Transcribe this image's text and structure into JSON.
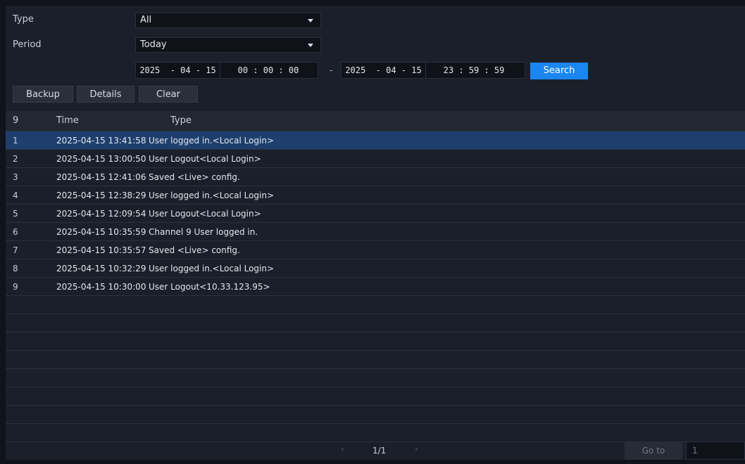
{
  "filters": {
    "type_label": "Type",
    "type_value": "All",
    "period_label": "Period",
    "period_value": "Today",
    "start_date": "2025  - 04 - 15",
    "start_time": "00 : 00 : 00",
    "range_separator": "-",
    "end_date": "2025  - 04 - 15",
    "end_time": "23 : 59 : 59",
    "search_label": "Search"
  },
  "actions": {
    "backup_label": "Backup",
    "details_label": "Details",
    "clear_label": "Clear"
  },
  "table": {
    "headers": {
      "count": "9",
      "time": "Time",
      "type": "Type"
    },
    "rows": [
      {
        "no": "1",
        "time": "2025-04-15 13:41:58",
        "type": "User logged in.<Local Login>",
        "selected": true
      },
      {
        "no": "2",
        "time": "2025-04-15 13:00:50",
        "type": "User Logout<Local Login>"
      },
      {
        "no": "3",
        "time": "2025-04-15 12:41:06",
        "type": "Saved <Live> config."
      },
      {
        "no": "4",
        "time": "2025-04-15 12:38:29",
        "type": "User logged in.<Local Login>"
      },
      {
        "no": "5",
        "time": "2025-04-15 12:09:54",
        "type": "User Logout<Local Login>"
      },
      {
        "no": "6",
        "time": "2025-04-15 10:35:59",
        "type": "Channel 9 User logged in."
      },
      {
        "no": "7",
        "time": "2025-04-15 10:35:57",
        "type": "Saved <Live> config."
      },
      {
        "no": "8",
        "time": "2025-04-15 10:32:29",
        "type": "User logged in.<Local Login>"
      },
      {
        "no": "9",
        "time": "2025-04-15 10:30:00",
        "type": "User Logout<10.33.123.95>"
      }
    ]
  },
  "pagination": {
    "prev_icon": "chevron-left-icon",
    "page_text": "1/1",
    "next_icon": "chevron-right-icon",
    "goto_label": "Go to",
    "goto_value": "1"
  },
  "colors": {
    "accent": "#1b86f0",
    "selected_row": "#1e3f6e",
    "background": "#1b1f2a"
  }
}
